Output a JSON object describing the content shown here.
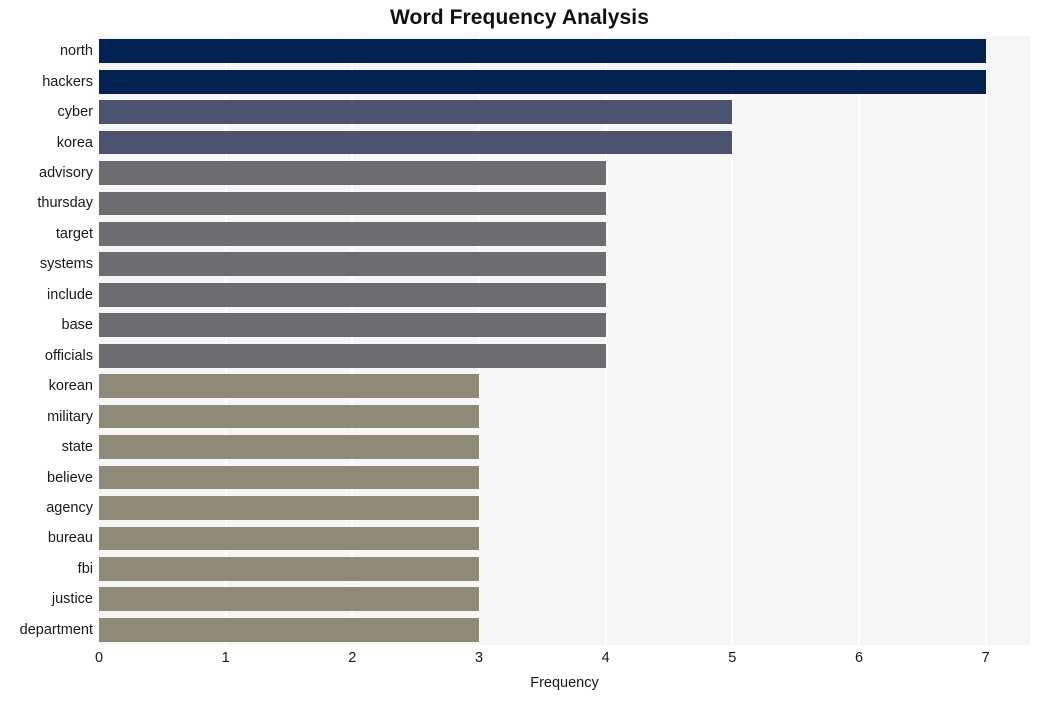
{
  "chart_data": {
    "type": "bar",
    "orientation": "horizontal",
    "title": "Word Frequency Analysis",
    "xlabel": "Frequency",
    "ylabel": "",
    "xlim": [
      0,
      7.35
    ],
    "ylim": null,
    "grid": true,
    "legend": null,
    "xticks": [
      0,
      1,
      2,
      3,
      4,
      5,
      6,
      7
    ],
    "xtick_labels": [
      "0",
      "1",
      "2",
      "3",
      "4",
      "5",
      "6",
      "7"
    ],
    "categories": [
      "north",
      "hackers",
      "cyber",
      "korea",
      "advisory",
      "thursday",
      "target",
      "systems",
      "include",
      "base",
      "officials",
      "korean",
      "military",
      "state",
      "believe",
      "agency",
      "bureau",
      "fbi",
      "justice",
      "department"
    ],
    "values": [
      7,
      7,
      5,
      5,
      4,
      4,
      4,
      4,
      4,
      4,
      4,
      3,
      3,
      3,
      3,
      3,
      3,
      3,
      3,
      3
    ],
    "bar_colors": [
      "#022352",
      "#022352",
      "#4c5371",
      "#4c5371",
      "#6b6d71",
      "#6b6d71",
      "#6b6d71",
      "#6b6d71",
      "#6b6d71",
      "#6b6d71",
      "#6b6d71",
      "#8e8a77",
      "#8e8a77",
      "#8e8a77",
      "#8e8a77",
      "#8e8a77",
      "#8e8a77",
      "#8e8a77",
      "#8e8a77",
      "#8e8a77"
    ]
  },
  "style": {
    "plot_background": "#f6f6f7",
    "page_background": "#ffffff",
    "gridline_color": "#ffffff",
    "text_color": "#18191c",
    "title_color": "#111114"
  }
}
